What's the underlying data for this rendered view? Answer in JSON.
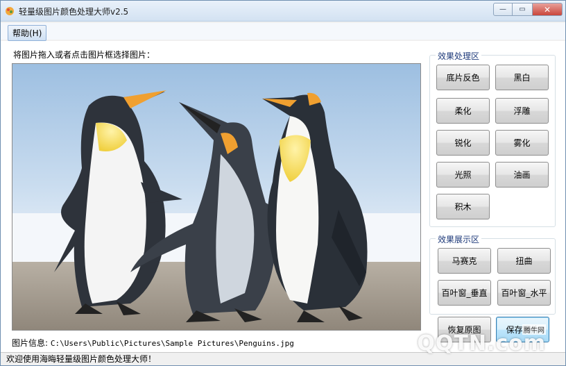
{
  "window": {
    "title": "轻量级图片颜色处理大师v2.5",
    "controls": {
      "minimize": "—",
      "maximize": "▭",
      "close": "✕"
    }
  },
  "menu": {
    "help": "帮助(H)"
  },
  "main": {
    "hint": "将图片拖入或者点击图片框选择图片：",
    "info_label": "图片信息:",
    "info_path": "C:\\Users\\Public\\Pictures\\Sample Pictures\\Penguins.jpg"
  },
  "effects_group": {
    "title": "效果处理区",
    "buttons": [
      "底片反色",
      "黑白",
      "柔化",
      "浮雕",
      "锐化",
      "雾化",
      "光照",
      "油画",
      "积木"
    ]
  },
  "display_group": {
    "title": "效果展示区",
    "buttons": [
      "马赛克",
      "扭曲",
      "百叶窗_垂直",
      "百叶窗_水平"
    ]
  },
  "actions": {
    "restore": "恢复原图",
    "save": "保存图片"
  },
  "statusbar": {
    "text": "欢迎使用海晦轻量级图片颜色处理大师！"
  },
  "watermark": {
    "site": "QQTN.com",
    "tag": "腾牛网"
  },
  "colors": {
    "group_title": "#1e3a7a",
    "close_button": "#c9473c"
  }
}
